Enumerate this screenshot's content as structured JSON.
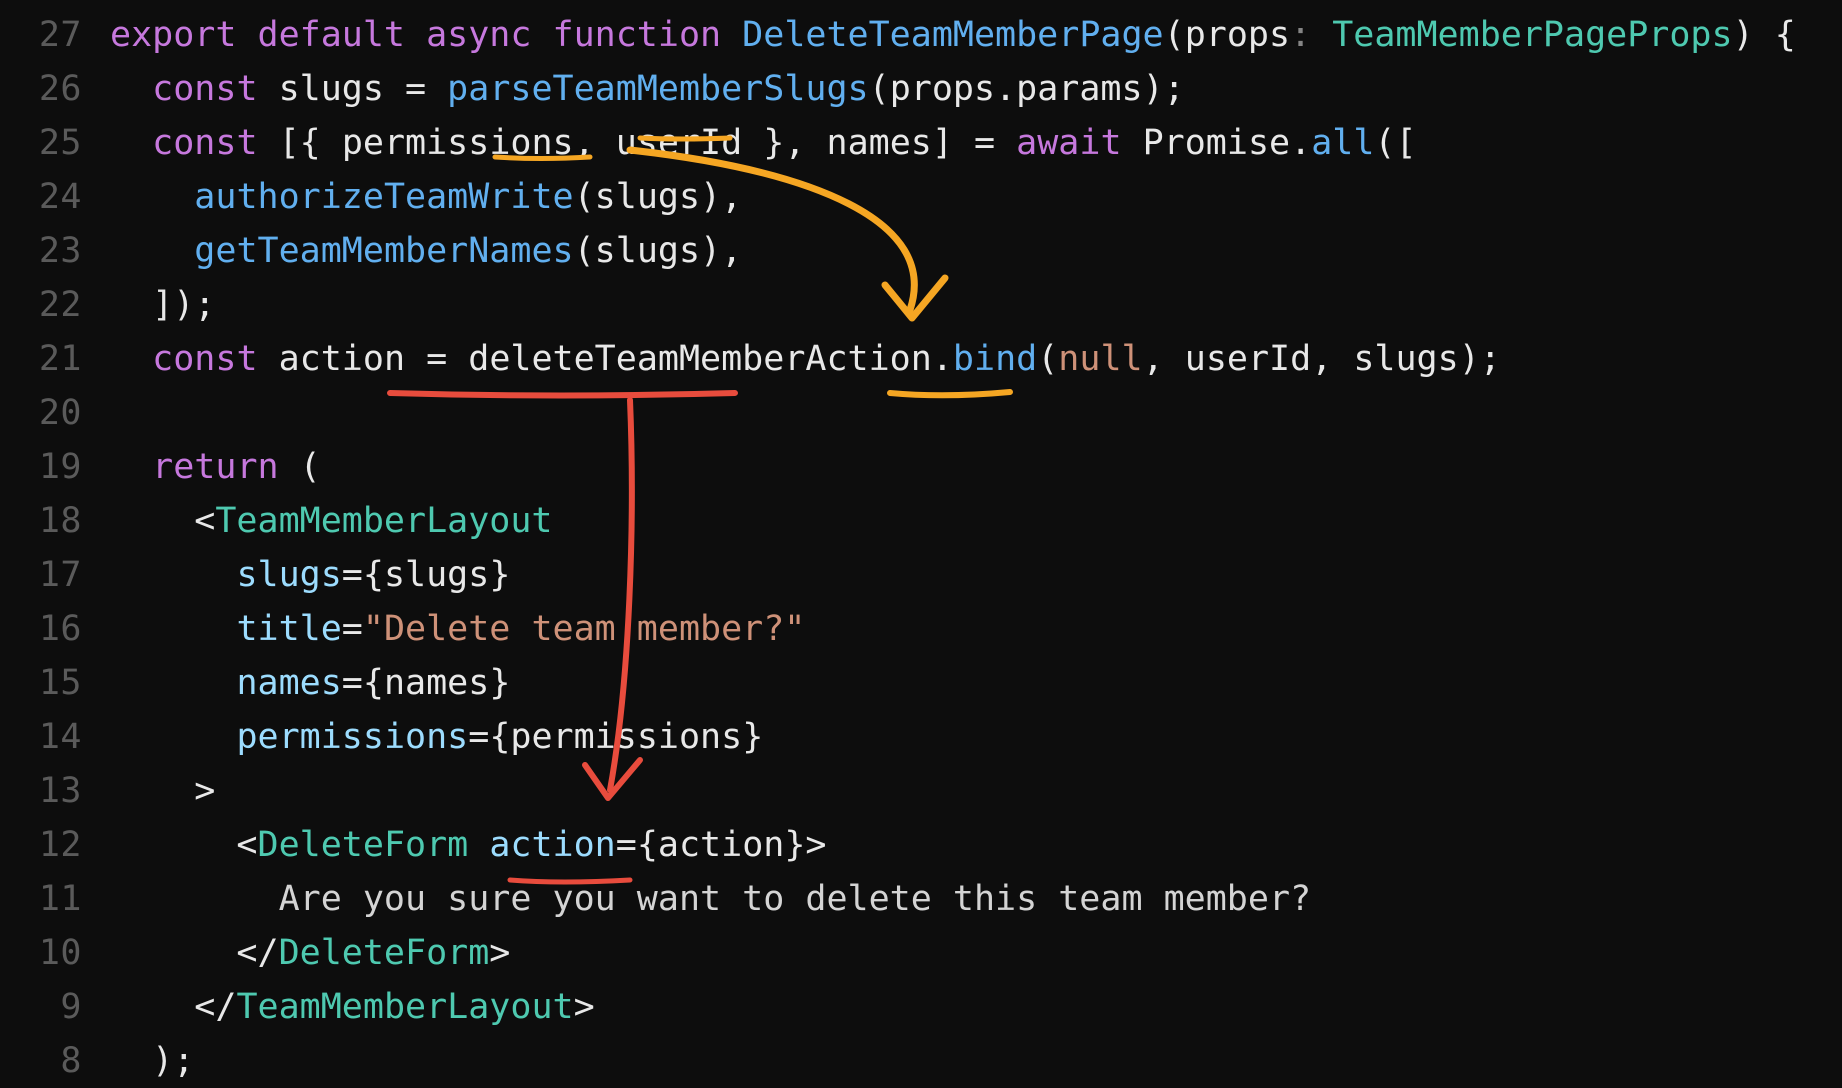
{
  "lineNumbers": [
    "27",
    "26",
    "25",
    "24",
    "23",
    "22",
    "21",
    "20",
    "19",
    "18",
    "17",
    "16",
    "15",
    "14",
    "13",
    "12",
    "11",
    "10",
    "9",
    "8"
  ],
  "code": {
    "l27": {
      "t1": "export default async ",
      "t2": "function ",
      "t3": "DeleteTeamMemberPage",
      "t4": "(",
      "t5": "props",
      "t6": ": ",
      "t7": "TeamMemberPageProps",
      "t8": ") {"
    },
    "l26": {
      "t1": "  ",
      "t2": "const ",
      "t3": "slugs",
      "t4": " = ",
      "t5": "parseTeamMemberSlugs",
      "t6": "(",
      "t7": "props",
      "t8": ".",
      "t9": "params",
      "t10": ");"
    },
    "l25": {
      "t1": "  ",
      "t2": "const ",
      "t3": "[{ ",
      "t4": "permissions",
      "t5": ", ",
      "t6": "userId",
      "t7": " }, ",
      "t8": "names",
      "t9": "] = ",
      "t10": "await ",
      "t11": "Promise",
      "t12": ".",
      "t13": "all",
      "t14": "(["
    },
    "l24": {
      "t1": "    ",
      "t2": "authorizeTeamWrite",
      "t3": "(",
      "t4": "slugs",
      "t5": "),"
    },
    "l23": {
      "t1": "    ",
      "t2": "getTeamMemberNames",
      "t3": "(",
      "t4": "slugs",
      "t5": "),"
    },
    "l22": {
      "t1": "  ]);"
    },
    "l21": {
      "t1": "  ",
      "t2": "const ",
      "t3": "action",
      "t4": " = ",
      "t5": "deleteTeamMemberAction",
      "t6": ".",
      "t7": "bind",
      "t8": "(",
      "t9": "null",
      "t10": ", ",
      "t11": "userId",
      "t12": ", ",
      "t13": "slugs",
      "t14": ");"
    },
    "l20": {
      "t1": ""
    },
    "l19": {
      "t1": "  ",
      "t2": "return ",
      "t3": "("
    },
    "l18": {
      "t1": "    <",
      "t2": "TeamMemberLayout"
    },
    "l17": {
      "t1": "      ",
      "t2": "slugs",
      "t3": "=",
      "t4": "{",
      "t5": "slugs",
      "t6": "}"
    },
    "l16": {
      "t1": "      ",
      "t2": "title",
      "t3": "=",
      "t4": "\"Delete team member?\""
    },
    "l15": {
      "t1": "      ",
      "t2": "names",
      "t3": "=",
      "t4": "{",
      "t5": "names",
      "t6": "}"
    },
    "l14": {
      "t1": "      ",
      "t2": "permissions",
      "t3": "=",
      "t4": "{",
      "t5": "permissions",
      "t6": "}"
    },
    "l13": {
      "t1": "    >"
    },
    "l12": {
      "t1": "      <",
      "t2": "DeleteForm",
      "t3": " ",
      "t4": "action",
      "t5": "=",
      "t6": "{",
      "t7": "action",
      "t8": "}",
      "t9": ">"
    },
    "l11": {
      "t1": "        Are you sure you want to delete this team member?"
    },
    "l10": {
      "t1": "      </",
      "t2": "DeleteForm",
      "t3": ">"
    },
    "l9": {
      "t1": "    </",
      "t2": "TeamMemberLayout",
      "t3": ">"
    },
    "l8": {
      "t1": "  );"
    }
  },
  "annotations": {
    "orangeCurvedArrow": "from names/userId on line 25 down to userId on line 21",
    "orangeUnderlines": [
      "userId on line 25",
      "names strikethrough line 25",
      "userId on line 21"
    ],
    "redUnderline": "deleteTeamMemberAction.bind on line 21",
    "redUnderline2": "{action} on line 12",
    "redArrow": "from line 21 down to action prop on line 12",
    "colors": {
      "orange": "#f5a623",
      "red": "#e84c3d"
    }
  }
}
